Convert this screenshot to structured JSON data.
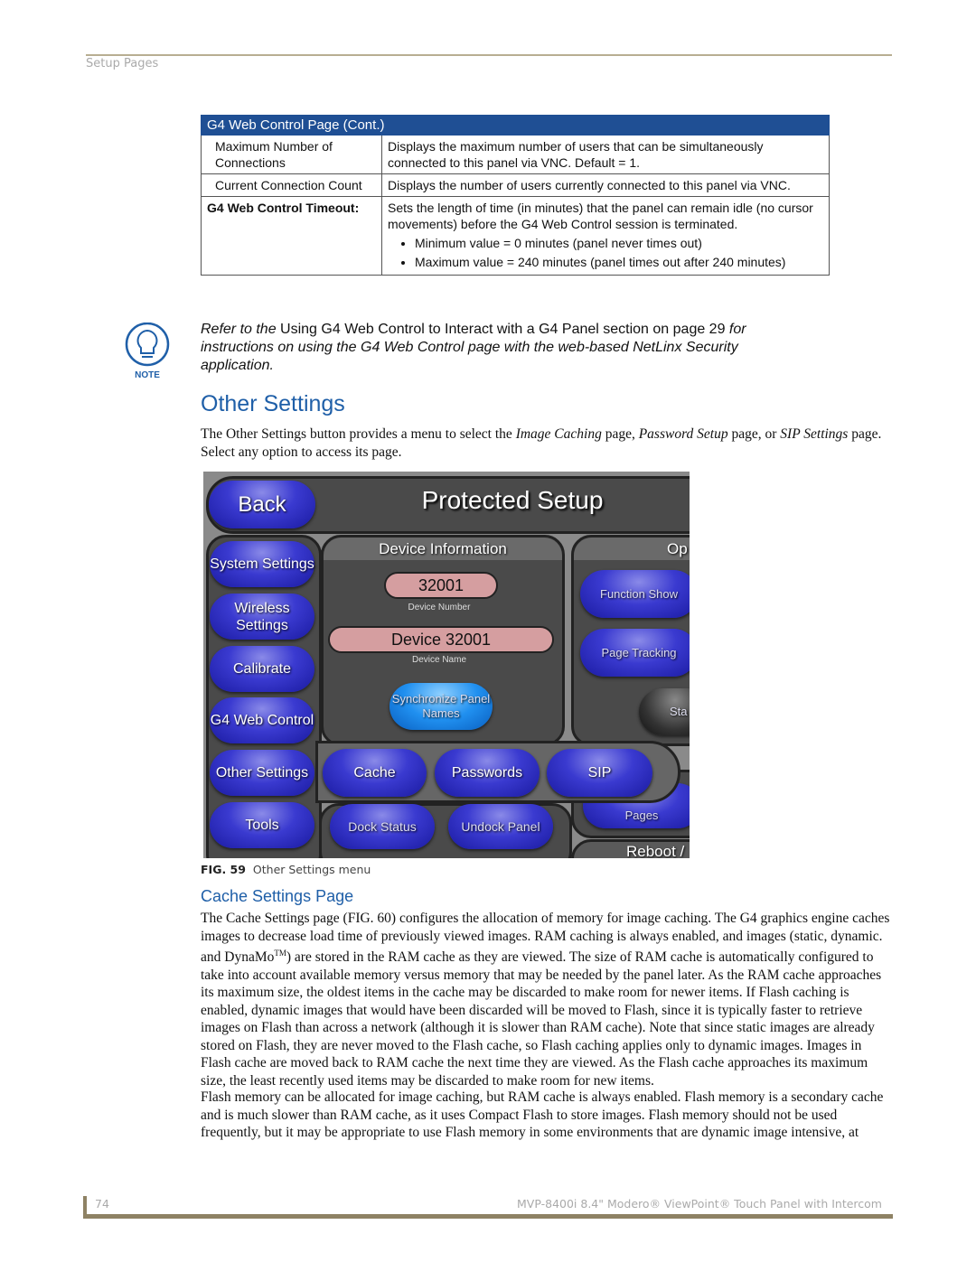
{
  "header": {
    "section": "Setup Pages"
  },
  "table": {
    "title": "G4 Web Control Page (Cont.)",
    "rows": [
      {
        "label": "Maximum Number of Connections",
        "desc": "Displays the maximum number of users that can be simultaneously connected to this panel via VNC. Default = 1."
      },
      {
        "label": "Current Connection Count",
        "desc": "Displays the number of users currently connected to this panel via VNC."
      },
      {
        "label": "G4 Web Control Timeout:",
        "desc": "Sets the length of time (in minutes) that the panel can remain idle (no cursor movements) before the G4 Web Control session is terminated.",
        "bullets": [
          "Minimum value = 0 minutes (panel never times out)",
          "Maximum value = 240 minutes (panel times out after 240 minutes)"
        ]
      }
    ]
  },
  "note": {
    "icon": "lightbulb-icon",
    "label": "NOTE",
    "prefix": "Refer to the ",
    "link": "Using G4 Web Control to Interact with a G4 Panel",
    "mid": " section on page 29 ",
    "suffix": "for instructions on using the G4 Web Control page with the web-based NetLinx Security application."
  },
  "other_settings": {
    "heading": "Other Settings",
    "intro": {
      "a": "The Other Settings button provides a menu to select the ",
      "b": "Image Caching",
      "c": " page, ",
      "d": "Password Setup",
      "e": " page, or ",
      "f": "SIP Settings",
      "g": " page. Select any option to access its page."
    }
  },
  "panel": {
    "back": "Back",
    "title": "Protected Setup",
    "left": [
      "System Settings",
      "Wireless Settings",
      "Calibrate",
      "G4 Web Control",
      "Other Settings",
      "Tools"
    ],
    "device_info": {
      "header": "Device Information",
      "number": "32001",
      "number_label": "Device Number",
      "name": "Device 32001",
      "name_label": "Device Name",
      "sync": "Synchronize Panel Names"
    },
    "options": {
      "header": "Op",
      "function_show": "Function Show",
      "page_tracking": "Page Tracking",
      "start": "Sta Se",
      "pages": "Pages",
      "reboot": "Reboot /"
    },
    "menu": [
      "Cache",
      "Passwords",
      "SIP"
    ],
    "bottom": [
      "Dock Status",
      "Undock Panel"
    ]
  },
  "figure": {
    "num": "FIG. 59",
    "caption": "Other Settings menu"
  },
  "cache": {
    "heading": "Cache Settings Page",
    "p1a": "The Cache Settings page (FIG. 60) configures the allocation of memory for image caching. The G4 graphics engine caches images to decrease load time of previously viewed images. RAM caching is always enabled, and images (static, dynamic. and DynaMo",
    "tm": "TM",
    "p1b": ") are stored in the RAM cache as they are viewed. The size of RAM cache is automatically configured to take into account available memory versus memory that may be needed by the panel later. As the RAM cache approaches its maximum size, the oldest items in the cache may be discarded to make room for newer items. If Flash caching is enabled, dynamic images that would have been discarded will be moved to Flash, since it is typically faster to retrieve images on Flash than across a network (although it is slower than RAM cache). Note that since static images are already stored on Flash, they are never moved to the Flash cache, so Flash caching applies only to dynamic images. Images in Flash cache are moved back to RAM cache the next time they are viewed. As the Flash cache approaches its maximum size, the least recently used items may be discarded to make room for new items.",
    "p2": "Flash memory can be allocated for image caching, but RAM cache is always enabled. Flash memory is a secondary cache and is much slower than RAM cache, as it uses Compact Flash to store images. Flash memory should not be used frequently, but it may be appropriate to use Flash memory in some environments that are dynamic image intensive, at"
  },
  "footer": {
    "page": "74",
    "title": "MVP-8400i 8.4\" Modero® ViewPoint® Touch Panel with Intercom"
  }
}
